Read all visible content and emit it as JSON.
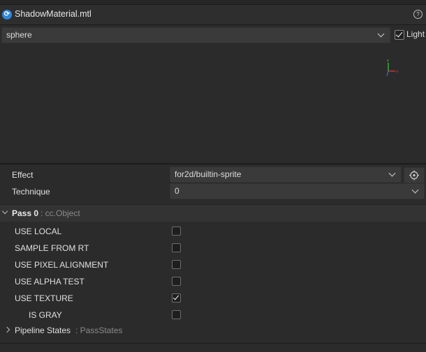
{
  "header": {
    "icon": "cocos-logo-icon",
    "title": "ShadowMaterial.mtl",
    "help_icon_label": "?"
  },
  "preview": {
    "shape": "sphere",
    "light_label": "Light",
    "light_checked": true,
    "axes": {
      "x": "x",
      "y": "y"
    }
  },
  "effect": {
    "label": "Effect",
    "value": "for2d/builtin-sprite"
  },
  "technique": {
    "label": "Technique",
    "value": "0"
  },
  "pass": {
    "name": "Pass 0",
    "type": ": cc.Object"
  },
  "defines": [
    {
      "label": "USE LOCAL",
      "checked": false
    },
    {
      "label": "SAMPLE FROM RT",
      "checked": false
    },
    {
      "label": "USE PIXEL ALIGNMENT",
      "checked": false
    },
    {
      "label": "USE ALPHA TEST",
      "checked": false
    },
    {
      "label": "USE TEXTURE",
      "checked": true
    },
    {
      "label": "IS GRAY",
      "checked": false
    }
  ],
  "pipeline": {
    "name": "Pipeline States",
    "type": ": PassStates"
  },
  "colors": {
    "background": "#2b2b2b",
    "field": "#3a3a3a",
    "axis_x": "#e03c3c",
    "axis_y": "#3ccf3c",
    "axis_z": "#3c6ee0",
    "icon_blue": "#2f86d9"
  }
}
